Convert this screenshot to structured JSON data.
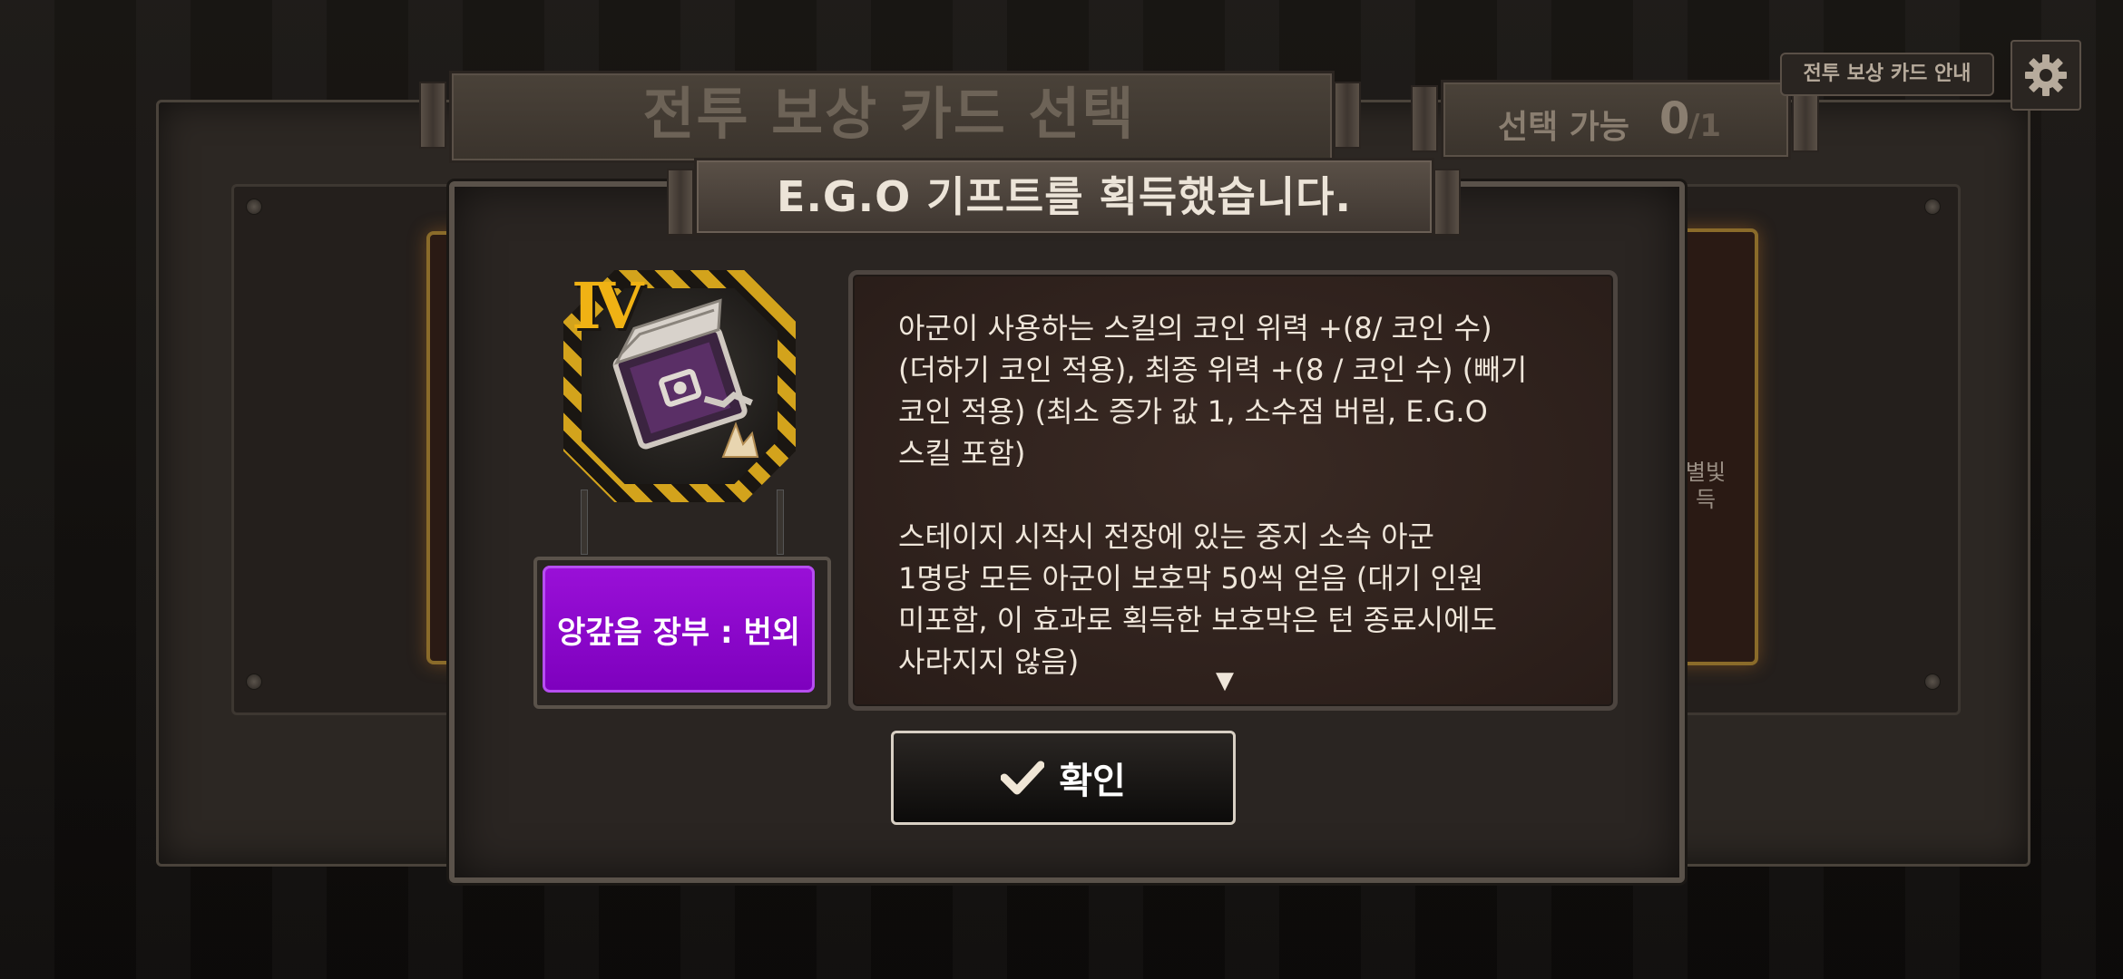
{
  "header": {
    "title": "전투 보상 카드 선택",
    "selectable_label": "선택 가능",
    "selected_count": "0",
    "max_count": "/1",
    "guide_button": "전투 보상 카드 안내"
  },
  "modal": {
    "title": "E.G.O 기프트를 획득했습니다.",
    "gift": {
      "tier": "Ⅳ",
      "name": "앙갚음 장부 : 번외",
      "name_color": "#8e06cf"
    },
    "description": "아군이 사용하는 스킬의 코인 위력 +(8/ 코인 수)\n(더하기 코인 적용), 최종 위력 +(8 / 코인 수) (빼기\n코인 적용) (최소 증가 값 1, 소수점 버림, E.G.O\n스킬 포함)\n\n스테이지 시작시 전장에 있는 중지 소속 아군\n1명당 모든 아군이 보호막 50씩 얻음 (대기 인원\n미포함, 이 효과로 획득한 보호막은 턴 종료시에도\n사라지지 않음)",
    "confirm_button": "확인"
  },
  "background_card": {
    "partial_text_line1": "별빛",
    "partial_text_line2": "득"
  },
  "icons": [
    "settings-gear-icon",
    "checkmark-icon",
    "scroll-down-arrow-icon",
    "ledger-book-icon"
  ]
}
